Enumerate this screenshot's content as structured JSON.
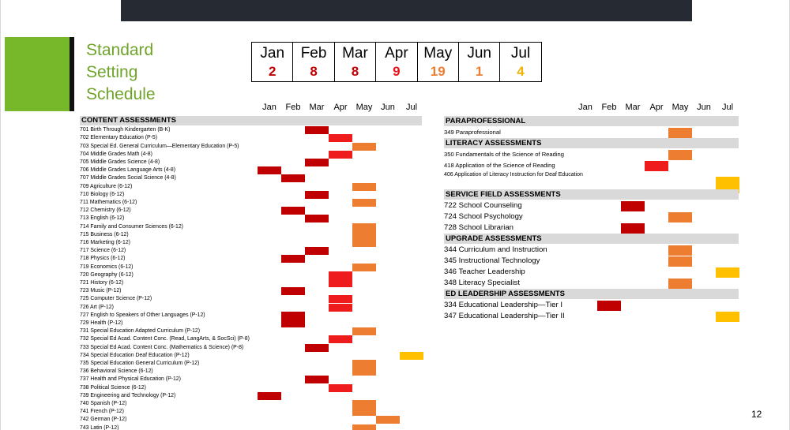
{
  "title_lines": [
    "Standard",
    "Setting",
    "Schedule"
  ],
  "page_number": "12",
  "colors": {
    "dark_red": "#c00000",
    "red": "#ee1c1c",
    "orange": "#ed7d31",
    "yellow": "#ffc000",
    "title_green": "#6fa32a",
    "section_gray": "#d9d9d9",
    "accent_green": "#76b82a"
  },
  "summary": [
    {
      "month": "Jan",
      "count": "2",
      "color": "#c00000"
    },
    {
      "month": "Feb",
      "count": "8",
      "color": "#c00000"
    },
    {
      "month": "Mar",
      "count": "8",
      "color": "#c00000"
    },
    {
      "month": "Apr",
      "count": "9",
      "color": "#e8141c"
    },
    {
      "month": "May",
      "count": "19",
      "color": "#ed7d31"
    },
    {
      "month": "Jun",
      "count": "1",
      "color": "#ed7d31"
    },
    {
      "month": "Jul",
      "count": "4",
      "color": "#f0b400"
    }
  ],
  "months": [
    "Jan",
    "Feb",
    "Mar",
    "Apr",
    "May",
    "Jun",
    "Jul"
  ],
  "left_sections": [
    {
      "name": "CONTENT ASSESSMENTS",
      "items": [
        {
          "label": "701 Birth Through Kindergarten (B-K)",
          "month": 2,
          "color": "#c00000"
        },
        {
          "label": "702 Elementary Education (P-5)",
          "month": 3,
          "color": "#ee1c1c"
        },
        {
          "label": "703 Special Ed. General Curriculum—Elementary Education (P-5)",
          "month": 4,
          "color": "#ed7d31"
        },
        {
          "label": "704 Middle Grades Math (4-8)",
          "month": 3,
          "color": "#ee1c1c"
        },
        {
          "label": "705 Middle Grades Science (4-8)",
          "month": 2,
          "color": "#c00000"
        },
        {
          "label": "706 Middle Grades Language Arts (4-8)",
          "month": 0,
          "color": "#c00000"
        },
        {
          "label": "707 Middle Grades Social Science (4-8)",
          "month": 1,
          "color": "#c00000"
        },
        {
          "label": "709 Agriculture (6-12)",
          "month": 4,
          "color": "#ed7d31"
        },
        {
          "label": "710 Biology (6-12)",
          "month": 2,
          "color": "#c00000"
        },
        {
          "label": "711 Mathematics (6-12)",
          "month": 4,
          "color": "#ed7d31"
        },
        {
          "label": "712 Chemistry (6-12)",
          "month": 1,
          "color": "#c00000"
        },
        {
          "label": "713 English (6-12)",
          "month": 2,
          "color": "#c00000"
        },
        {
          "label": "714 Family and Consumer Sciences (6-12)",
          "month": 4,
          "color": "#ed7d31"
        },
        {
          "label": "715 Business (6-12)",
          "month": 4,
          "color": "#ed7d31"
        },
        {
          "label": "716 Marketing (6-12)",
          "month": 4,
          "color": "#ed7d31"
        },
        {
          "label": "717 Science (6-12)",
          "month": 2,
          "color": "#c00000"
        },
        {
          "label": "718 Physics (6-12)",
          "month": 1,
          "color": "#c00000"
        },
        {
          "label": "719 Economics (6-12)",
          "month": 4,
          "color": "#ed7d31"
        },
        {
          "label": "720 Geography (6-12)",
          "month": 3,
          "color": "#ee1c1c"
        },
        {
          "label": "721 History (6-12)",
          "month": 3,
          "color": "#ee1c1c"
        },
        {
          "label": "723 Music (P-12)",
          "month": 1,
          "color": "#c00000"
        },
        {
          "label": "725 Computer Science (P-12)",
          "month": 3,
          "color": "#ee1c1c"
        },
        {
          "label": "726 Art (P-12)",
          "month": 3,
          "color": "#ee1c1c"
        },
        {
          "label": "727 English to Speakers of Other Languages (P-12)",
          "month": 1,
          "color": "#c00000"
        },
        {
          "label": "729 Health (P-12)",
          "month": 1,
          "color": "#c00000"
        },
        {
          "label": "731 Special Education Adapted Curriculum (P-12)",
          "month": 4,
          "color": "#ed7d31"
        },
        {
          "label": "732 Special Ed Acad. Content Conc. (Read, LangArts, & SocSci) (P-8)",
          "month": 3,
          "color": "#ee1c1c"
        },
        {
          "label": "733 Special Ed Acad. Content Conc. (Mathematics & Science) (P-8)",
          "month": 2,
          "color": "#c00000"
        },
        {
          "label": "734 Special Education Deaf Education (P-12)",
          "month": 6,
          "color": "#ffc000"
        },
        {
          "label": "735 Special Education General Curriculum (P-12)",
          "month": 4,
          "color": "#ed7d31"
        },
        {
          "label": "736 Behavioral Science (6-12)",
          "month": 4,
          "color": "#ed7d31"
        },
        {
          "label": "737 Health and Physical Education (P-12)",
          "month": 2,
          "color": "#c00000"
        },
        {
          "label": "738 Political Science (6-12)",
          "month": 3,
          "color": "#ee1c1c"
        },
        {
          "label": "739 Engineering and Technology (P-12)",
          "month": 0,
          "color": "#c00000"
        },
        {
          "label": "740 Spanish (P-12)",
          "month": 4,
          "color": "#ed7d31"
        },
        {
          "label": "741 French (P-12)",
          "month": 4,
          "color": "#ed7d31"
        },
        {
          "label": "742 German (P-12)",
          "month": 5,
          "color": "#ed7d31"
        },
        {
          "label": "743 Latin (P-12)",
          "month": 4,
          "color": "#ed7d31"
        }
      ]
    }
  ],
  "right_sections": [
    {
      "name": "PARAPROFESSIONAL",
      "items": [
        {
          "label": "349 Paraprofessional",
          "month": 4,
          "color": "#ed7d31",
          "size": "small"
        }
      ]
    },
    {
      "name": "LITERACY ASSESSMENTS",
      "items": [
        {
          "label": "350 Fundamentals of the Science of Reading",
          "month": 4,
          "color": "#ed7d31",
          "size": "small"
        },
        {
          "label": "418 Application of the Science of Reading",
          "month": 3,
          "color": "#ee1c1c",
          "size": "small"
        },
        {
          "label": "406 Application of Literacy Instruction for Deaf Education",
          "month": 6,
          "color": "#ffc000",
          "size": "small2"
        }
      ]
    },
    {
      "name": "SERVICE FIELD ASSESSMENTS",
      "items": [
        {
          "label": "722 School Counseling",
          "month": 2,
          "color": "#c00000",
          "size": "big"
        },
        {
          "label": "724 School Psychology",
          "month": 4,
          "color": "#ed7d31",
          "size": "big"
        },
        {
          "label": "728 School Librarian",
          "month": 2,
          "color": "#c00000",
          "size": "big"
        }
      ]
    },
    {
      "name": "UPGRADE ASSESSMENTS",
      "items": [
        {
          "label": "344 Curriculum and Instruction",
          "month": 4,
          "color": "#ed7d31",
          "size": "big"
        },
        {
          "label": "345 Instructional Technology",
          "month": 4,
          "color": "#ed7d31",
          "size": "big"
        },
        {
          "label": "346 Teacher Leadership",
          "month": 6,
          "color": "#ffc000",
          "size": "big"
        },
        {
          "label": "348 Literacy Specialist",
          "month": 4,
          "color": "#ed7d31",
          "size": "big"
        }
      ]
    },
    {
      "name": "ED LEADERSHIP ASSESSMENTS",
      "items": [
        {
          "label": "334 Educational Leadership—Tier I",
          "month": 1,
          "color": "#c00000",
          "size": "big"
        },
        {
          "label": "347 Educational Leadership—Tier II",
          "month": 6,
          "color": "#ffc000",
          "size": "big"
        }
      ]
    }
  ]
}
